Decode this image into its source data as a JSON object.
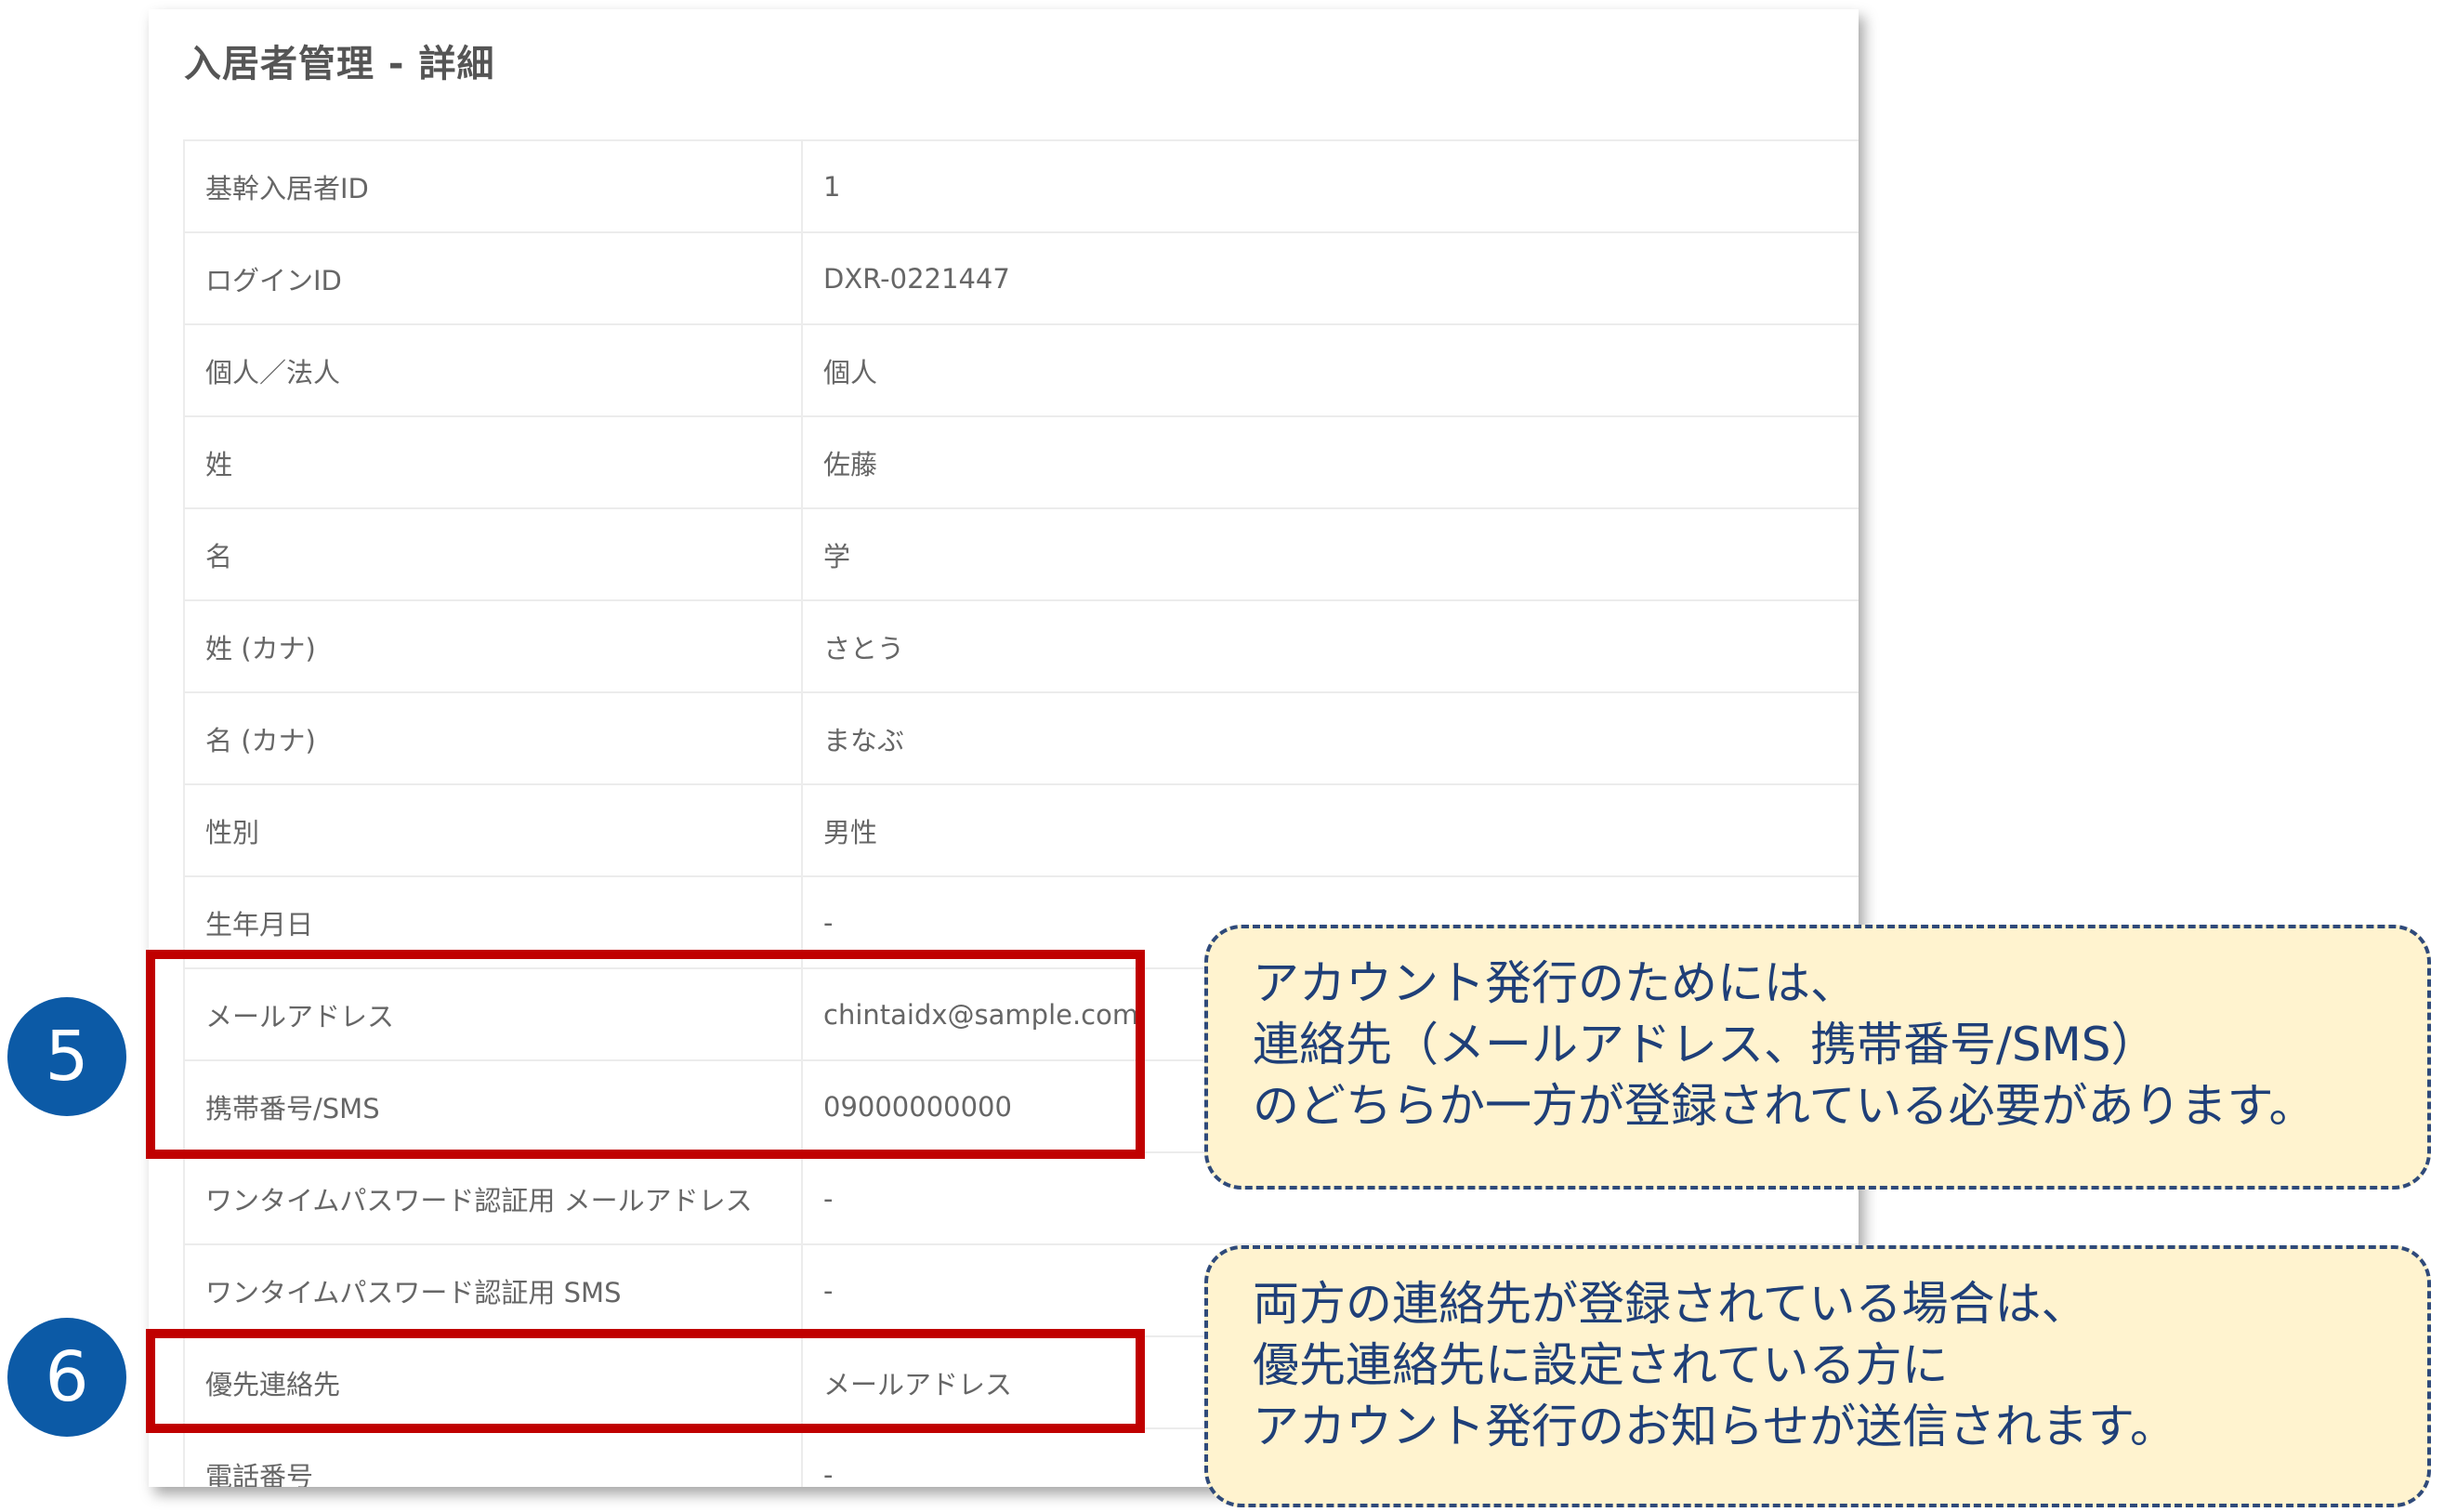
{
  "page": {
    "title": "入居者管理 - 詳細"
  },
  "detail_rows": [
    {
      "label": "基幹入居者ID",
      "value": "1"
    },
    {
      "label": "ログインID",
      "value": "DXR-0221447"
    },
    {
      "label": "個人／法人",
      "value": "個人"
    },
    {
      "label": "姓",
      "value": "佐藤"
    },
    {
      "label": "名",
      "value": "学"
    },
    {
      "label": "姓 (カナ)",
      "value": "さとう"
    },
    {
      "label": "名 (カナ)",
      "value": "まなぶ"
    },
    {
      "label": "性別",
      "value": "男性"
    },
    {
      "label": "生年月日",
      "value": "-"
    },
    {
      "label": "メールアドレス",
      "value": "chintaidx@sample.com"
    },
    {
      "label": "携帯番号/SMS",
      "value": "09000000000"
    },
    {
      "label": "ワンタイムパスワード認証用 メールアドレス",
      "value": "-"
    },
    {
      "label": "ワンタイムパスワード認証用 SMS",
      "value": "-"
    },
    {
      "label": "優先連絡先",
      "value": "メールアドレス"
    },
    {
      "label": "電話番号",
      "value": "-"
    }
  ],
  "annotations": {
    "step5": {
      "number": "5",
      "lines": [
        "アカウント発行のためには、",
        "連絡先（メールアドレス、携帯番号/SMS）",
        "のどちらか一方が登録されている必要があります。"
      ]
    },
    "step6": {
      "number": "6",
      "lines": [
        "両方の連絡先が登録されている場合は、",
        "優先連絡先に設定されている方に",
        "アカウント発行のお知らせが送信されます。"
      ]
    }
  },
  "colors": {
    "highlight": "#c00000",
    "badge": "#0c5aa6",
    "callout_bg": "#fff3cf",
    "callout_border": "#2f4a7a",
    "callout_text": "#1f3f78"
  }
}
